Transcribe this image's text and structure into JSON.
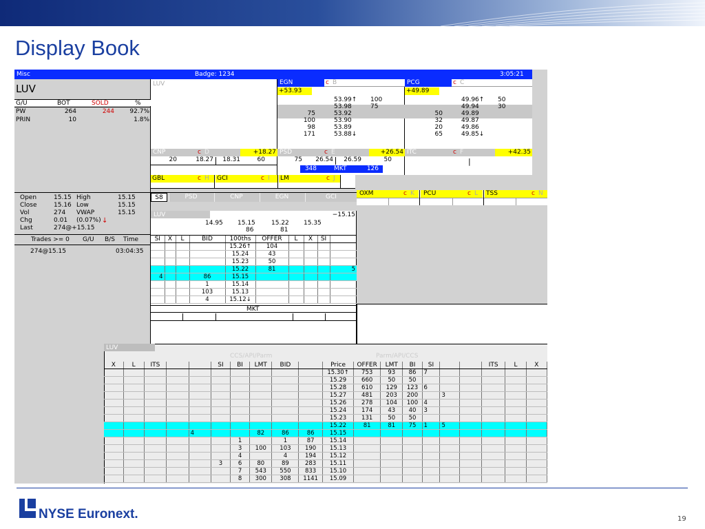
{
  "slide": {
    "title": "Display Book",
    "page": "19",
    "logo_text": "NYSE Euronext."
  },
  "header": {
    "left": "Misc",
    "badge": "Badge: 1234",
    "time": "3:05:21"
  },
  "stock": {
    "symbol": "LUV",
    "cols": [
      "G/U",
      "BOT",
      "SOLD",
      "%"
    ],
    "rows": [
      [
        "PW",
        "264",
        "244",
        "92.7%"
      ],
      [
        "PRIN",
        "10",
        "",
        "1.8%"
      ]
    ]
  },
  "luv_panel": {
    "label": "LUV"
  },
  "quotes": {
    "egn": {
      "sym": "EGN",
      "c": "c",
      "letter": "B",
      "chg": "+53.93",
      "rows": [
        [
          "",
          "53.99↑",
          "100"
        ],
        [
          "",
          "53.98",
          "75"
        ],
        [
          "75",
          "53.92",
          ""
        ],
        [
          "100",
          "53.90",
          ""
        ],
        [
          "98",
          "53.89",
          ""
        ],
        [
          "171",
          "53.88↓",
          ""
        ]
      ]
    },
    "pcg": {
      "sym": "PCG",
      "c": "c",
      "letter": "C",
      "chg": "+49.89",
      "rows": [
        [
          "",
          "49.96↑",
          "50"
        ],
        [
          "",
          "49.94",
          "30"
        ],
        [
          "50",
          "49.89",
          ""
        ],
        [
          "32",
          "49.87",
          ""
        ],
        [
          "20",
          "49.86",
          ""
        ],
        [
          "65",
          "49.85↓",
          ""
        ]
      ]
    },
    "cnp": {
      "sym": "CNP",
      "c": "c",
      "letter": "D",
      "chg": "+18.27",
      "vals": [
        "20",
        "18.27",
        "18.31",
        "60"
      ]
    },
    "psd": {
      "sym": "PSD",
      "c": "c",
      "letter": "E",
      "chg": "+26.54",
      "vals": [
        "75",
        "26.54",
        "26.59",
        "50"
      ],
      "mkt": [
        "348",
        "MKT",
        "126"
      ]
    },
    "itc": {
      "sym": "ITC",
      "c": "c",
      "letter": "F",
      "chg": "+42.35",
      "cursor": "|"
    },
    "gbl": {
      "sym": "GBL",
      "c": "c",
      "letter": "H"
    },
    "gci": {
      "sym": "GCI",
      "c": "c",
      "letter": "I"
    },
    "lm": {
      "sym": "LM",
      "c": "c",
      "letter": "J"
    },
    "oxm": {
      "sym": "OXM",
      "c": "c",
      "letter": "K"
    },
    "pcu": {
      "sym": "PCU",
      "c": "c",
      "letter": "L"
    },
    "tss": {
      "sym": "TSS",
      "c": "c",
      "letter": "N"
    }
  },
  "stats": {
    "rows": [
      [
        "Open",
        "15.15",
        "High",
        "15.15"
      ],
      [
        "Close",
        "15.16",
        "Low",
        "15.15"
      ],
      [
        "Vol",
        "274",
        "VWAP",
        "15.15"
      ],
      [
        "Chg",
        "0.01",
        "(0.07%)",
        ""
      ],
      [
        "Last",
        "274@+15.15",
        "",
        ""
      ]
    ],
    "chg_arrow": "↓",
    "trades_hdr": [
      "Trades >= 0",
      "G/U",
      "B/S",
      "Time"
    ],
    "trade": [
      "274@15.15",
      "03:04:35"
    ]
  },
  "tabs": [
    "S8",
    "PSD",
    "CNP",
    "EGN",
    "GCI"
  ],
  "book": {
    "sym": "LUV",
    "chg": "−15.15",
    "bbo": [
      "14.95",
      "15.15",
      "15.22",
      "15.35"
    ],
    "sizes": [
      "86",
      "81"
    ],
    "headers": [
      "SI",
      "X",
      "L",
      "BID",
      "100ths",
      "OFFER",
      "L",
      "X",
      "SI"
    ],
    "rows": [
      [
        "",
        "",
        "",
        "",
        "15.26↑",
        "104",
        "",
        "",
        "",
        ""
      ],
      [
        "",
        "",
        "",
        "",
        "15.24",
        "43",
        "",
        "",
        "",
        ""
      ],
      [
        "",
        "",
        "",
        "",
        "15.23",
        "50",
        "",
        "",
        "",
        ""
      ],
      [
        "",
        "",
        "",
        "",
        "15.22",
        "81",
        "",
        "",
        "5",
        "hl"
      ],
      [
        "4",
        "",
        "",
        "86",
        "15.15",
        "",
        "",
        "",
        "",
        "hl"
      ],
      [
        "",
        "",
        "",
        "1",
        "15.14",
        "",
        "",
        "",
        "",
        ""
      ],
      [
        "",
        "",
        "",
        "103",
        "15.13",
        "",
        "",
        "",
        "",
        ""
      ],
      [
        "",
        "",
        "",
        "4",
        "15.12↓",
        "",
        "",
        "",
        "",
        ""
      ]
    ],
    "mkt": "MKT"
  },
  "ladder": {
    "sym": "LUV",
    "left_title": "CCS/API/Parm",
    "right_title": "Parm/API/CCS",
    "headers": [
      "X",
      "L",
      "ITS",
      "",
      "",
      "SI",
      "BI",
      "LMT",
      "BID",
      "",
      "Price",
      "OFFER",
      "LMT",
      "BI",
      "SI",
      "",
      "",
      "ITS",
      "L",
      "X"
    ],
    "rows": [
      [
        "",
        "",
        "",
        "",
        "",
        "",
        "",
        "",
        "",
        "",
        "15.30↑",
        "753",
        "93",
        "86",
        "7",
        "",
        "",
        "",
        "",
        "",
        ""
      ],
      [
        "",
        "",
        "",
        "",
        "",
        "",
        "",
        "",
        "",
        "",
        "15.29",
        "660",
        "50",
        "50",
        "",
        "",
        "",
        "",
        "",
        "",
        ""
      ],
      [
        "",
        "",
        "",
        "",
        "",
        "",
        "",
        "",
        "",
        "",
        "15.28",
        "610",
        "129",
        "123",
        "6",
        "",
        "",
        "",
        "",
        "",
        ""
      ],
      [
        "",
        "",
        "",
        "",
        "",
        "",
        "",
        "",
        "",
        "",
        "15.27",
        "481",
        "203",
        "200",
        "",
        "3",
        "",
        "",
        "",
        "",
        ""
      ],
      [
        "",
        "",
        "",
        "",
        "",
        "",
        "",
        "",
        "",
        "",
        "15.26",
        "278",
        "104",
        "100",
        "4",
        "",
        "",
        "",
        "",
        "",
        ""
      ],
      [
        "",
        "",
        "",
        "",
        "",
        "",
        "",
        "",
        "",
        "",
        "15.24",
        "174",
        "43",
        "40",
        "3",
        "",
        "",
        "",
        "",
        "",
        ""
      ],
      [
        "",
        "",
        "",
        "",
        "",
        "",
        "",
        "",
        "",
        "",
        "15.23",
        "131",
        "50",
        "50",
        "",
        "",
        "",
        "",
        "",
        "",
        ""
      ],
      [
        "",
        "",
        "",
        "",
        "",
        "",
        "",
        "",
        "",
        "",
        "15.22",
        "81",
        "81",
        "75",
        "1",
        "5",
        "",
        "",
        "",
        "",
        "hl"
      ],
      [
        "",
        "",
        "",
        "",
        "4",
        "",
        "",
        "82",
        "86",
        "86",
        "15.15",
        "",
        "",
        "",
        "",
        "",
        "",
        "",
        "",
        "",
        "hl"
      ],
      [
        "",
        "",
        "",
        "",
        "",
        "",
        "1",
        "",
        "1",
        "87",
        "15.14",
        "",
        "",
        "",
        "",
        "",
        "",
        "",
        "",
        "",
        ""
      ],
      [
        "",
        "",
        "",
        "",
        "",
        "",
        "3",
        "100",
        "103",
        "190",
        "15.13",
        "",
        "",
        "",
        "",
        "",
        "",
        "",
        "",
        "",
        ""
      ],
      [
        "",
        "",
        "",
        "",
        "",
        "",
        "4",
        "",
        "4",
        "194",
        "15.12",
        "",
        "",
        "",
        "",
        "",
        "",
        "",
        "",
        "",
        ""
      ],
      [
        "",
        "",
        "",
        "",
        "",
        "3",
        "6",
        "80",
        "89",
        "283",
        "15.11",
        "",
        "",
        "",
        "",
        "",
        "",
        "",
        "",
        "",
        ""
      ],
      [
        "",
        "",
        "",
        "",
        "",
        "",
        "7",
        "543",
        "550",
        "833",
        "15.10",
        "",
        "",
        "",
        "",
        "",
        "",
        "",
        "",
        "",
        ""
      ],
      [
        "",
        "",
        "",
        "",
        "",
        "",
        "8",
        "300",
        "308",
        "1141",
        "15.09",
        "",
        "",
        "",
        "",
        "",
        "",
        "",
        "",
        "",
        ""
      ]
    ]
  },
  "colors": {
    "blue": "#0a2cff",
    "yellow": "#ffff00",
    "cyan": "#00ffff",
    "red": "#d00000",
    "gray": "#d2d2d2",
    "brand": "#1a3fa0"
  }
}
